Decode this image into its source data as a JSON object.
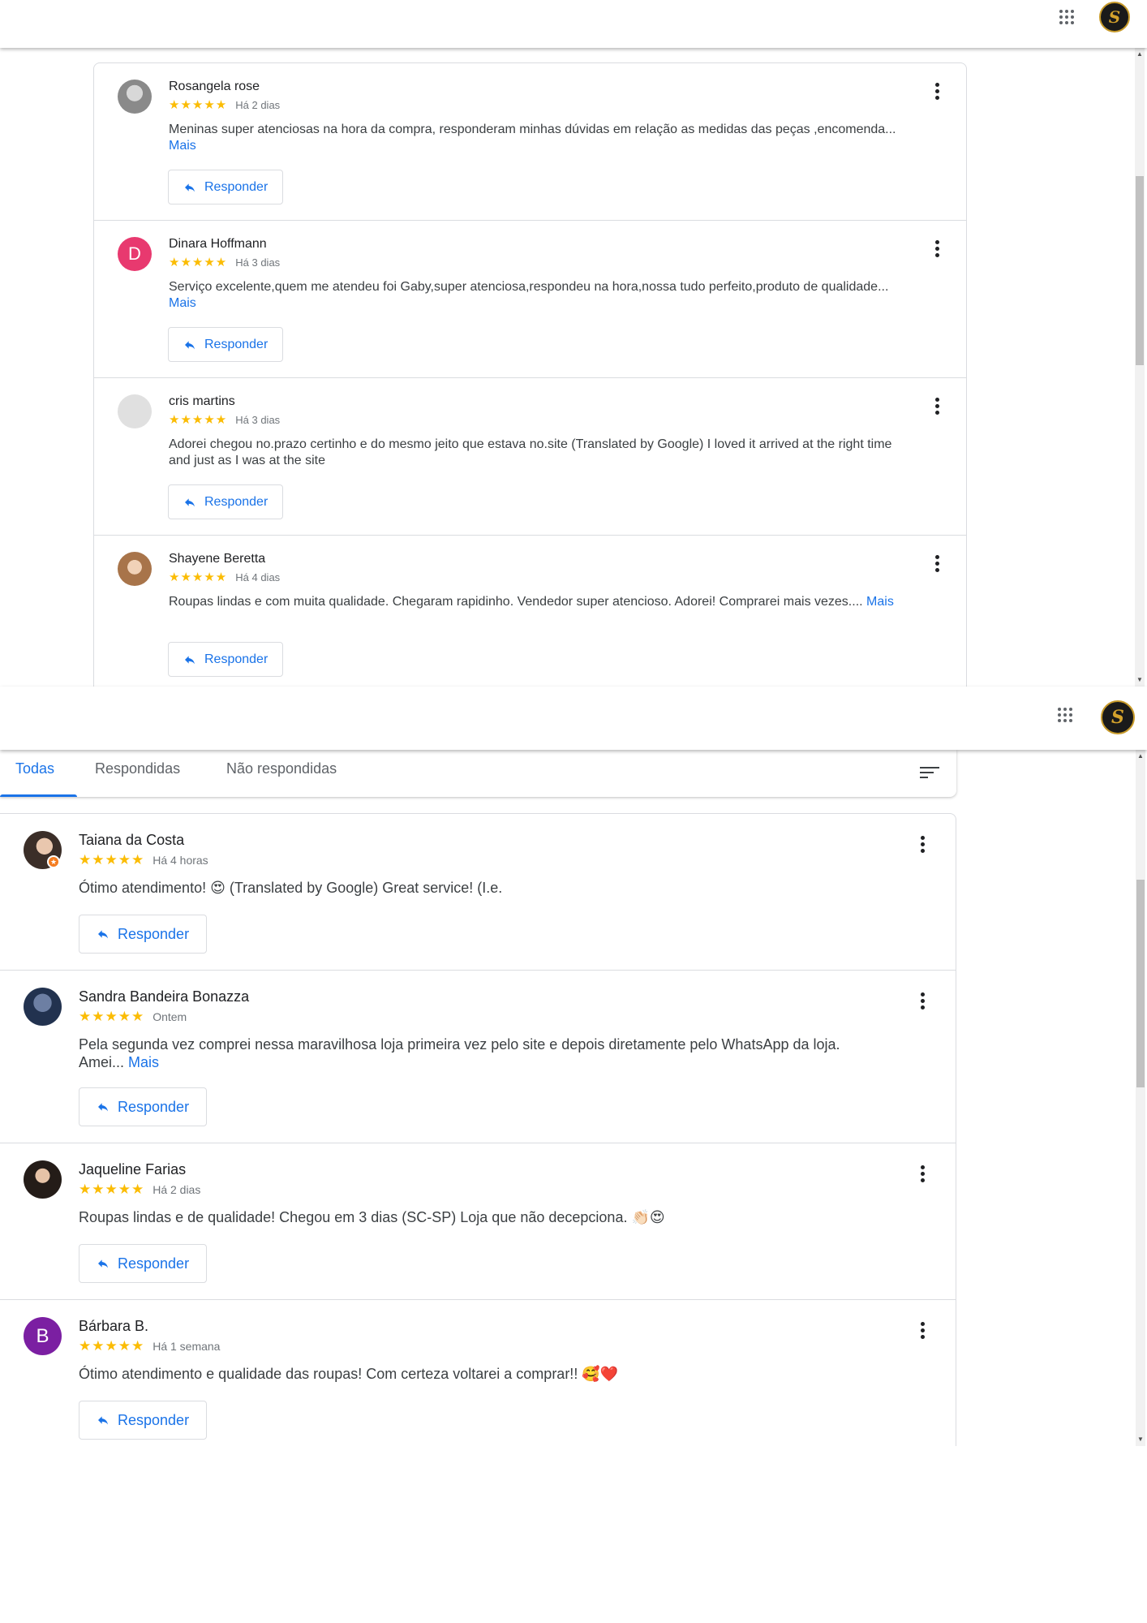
{
  "header": {
    "apps_icon": "apps-grid-icon",
    "account_logo_letter": "S"
  },
  "panel1_reviews": [
    {
      "name": "Rosangela rose",
      "stars": "★★★★★",
      "age": "Há 2 dias",
      "text": "Meninas super atenciosas na hora da compra, responderam minhas dúvidas em relação as medidas das peças ,encomenda... ",
      "more": "Mais",
      "reply": "Responder",
      "avatar": "photo",
      "avatar_color": "#9aa0a6"
    },
    {
      "name": "Dinara Hoffmann",
      "stars": "★★★★★",
      "age": "Há 3 dias",
      "text": "Serviço excelente,quem me atendeu foi Gaby,super atenciosa,respondeu na hora,nossa tudo perfeito,produto de qualidade... ",
      "more": "Mais",
      "reply": "Responder",
      "avatar_letter": "D",
      "avatar_color": "#e8396f"
    },
    {
      "name": "cris martins",
      "stars": "★★★★★",
      "age": "Há 3 dias",
      "text": "Adorei chegou no.prazo certinho e do mesmo jeito que estava no.site (Translated by Google) I loved it arrived at the right time and just as I was at the site",
      "more": "",
      "reply": "Responder",
      "avatar": "blank",
      "avatar_color": "#e0e0e0"
    },
    {
      "name": "Shayene Beretta",
      "stars": "★★★★★",
      "age": "Há 4 dias",
      "text": "Roupas lindas e com muita qualidade. Chegaram rapidinho. Vendedor super atencioso. Adorei! Comprarei mais vezes.... ",
      "more": "Mais",
      "reply": "Responder",
      "avatar": "photo",
      "avatar_color": "#b7835a"
    }
  ],
  "tabs": {
    "all": "Todas",
    "answered": "Respondidas",
    "unanswered": "Não respondidas",
    "active": "Todas",
    "filter_icon": "sort-filter-icon"
  },
  "panel2_reviews": [
    {
      "name": "Taiana da Costa",
      "stars": "★★★★★",
      "age": "Há 4 horas",
      "text": "Ótimo atendimento! 😍 (Translated by Google) Great service! (I.e.",
      "more": "",
      "reply": "Responder",
      "avatar": "photo",
      "avatar_color": "#5b4a40",
      "local_guide_badge": true
    },
    {
      "name": "Sandra Bandeira Bonazza",
      "stars": "★★★★★",
      "age": "Ontem",
      "text": "Pela segunda vez comprei nessa maravilhosa loja primeira vez pelo site e depois diretamente pelo WhatsApp da loja. Amei... ",
      "more": "Mais",
      "reply": "Responder",
      "avatar": "photo",
      "avatar_color": "#3a4e6e"
    },
    {
      "name": "Jaqueline Farias",
      "stars": "★★★★★",
      "age": "Há 2 dias",
      "text": "Roupas lindas e de qualidade! Chegou em 3 dias (SC-SP) Loja que não decepciona. 👏🏻😍",
      "more": "",
      "reply": "Responder",
      "avatar": "photo",
      "avatar_color": "#2b2320"
    },
    {
      "name": "Bárbara B.",
      "stars": "★★★★★",
      "age": "Há 1 semana",
      "text": "Ótimo atendimento e qualidade das roupas! Com certeza voltarei a comprar!! 🥰❤️",
      "more": "",
      "reply": "Responder",
      "avatar_letter": "B",
      "avatar_color": "#7b1fa2"
    }
  ]
}
